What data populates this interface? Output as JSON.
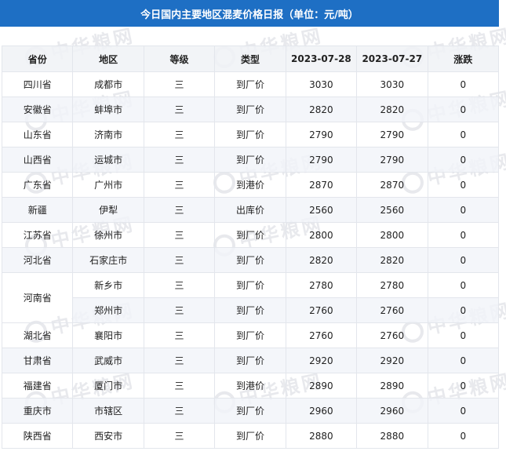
{
  "title": "今日国内主要地区混麦价格日报（单位：元/吨）",
  "watermark": "中华粮网",
  "headers": [
    "省份",
    "地区",
    "等级",
    "类型",
    "2023-07-28",
    "2023-07-27",
    "涨跌"
  ],
  "rows": [
    {
      "province": "四川省",
      "region": "成都市",
      "grade": "三",
      "type": "到厂价",
      "today": "3030",
      "prev": "3030",
      "change": "0"
    },
    {
      "province": "安徽省",
      "region": "蚌埠市",
      "grade": "三",
      "type": "到厂价",
      "today": "2820",
      "prev": "2820",
      "change": "0"
    },
    {
      "province": "山东省",
      "region": "济南市",
      "grade": "三",
      "type": "到厂价",
      "today": "2790",
      "prev": "2790",
      "change": "0"
    },
    {
      "province": "山西省",
      "region": "运城市",
      "grade": "三",
      "type": "到厂价",
      "today": "2790",
      "prev": "2790",
      "change": "0"
    },
    {
      "province": "广东省",
      "region": "广州市",
      "grade": "三",
      "type": "到港价",
      "today": "2870",
      "prev": "2870",
      "change": "0"
    },
    {
      "province": "新疆",
      "region": "伊犁",
      "grade": "三",
      "type": "出库价",
      "today": "2560",
      "prev": "2560",
      "change": "0"
    },
    {
      "province": "江苏省",
      "region": "徐州市",
      "grade": "三",
      "type": "到厂价",
      "today": "2800",
      "prev": "2800",
      "change": "0"
    },
    {
      "province": "河北省",
      "region": "石家庄市",
      "grade": "三",
      "type": "到厂价",
      "today": "2820",
      "prev": "2820",
      "change": "0"
    },
    {
      "province": "河南省",
      "region": "新乡市",
      "grade": "三",
      "type": "到厂价",
      "today": "2780",
      "prev": "2780",
      "change": "0"
    },
    {
      "province": "",
      "region": "郑州市",
      "grade": "三",
      "type": "到厂价",
      "today": "2760",
      "prev": "2760",
      "change": "0"
    },
    {
      "province": "湖北省",
      "region": "襄阳市",
      "grade": "三",
      "type": "到厂价",
      "today": "2760",
      "prev": "2760",
      "change": "0"
    },
    {
      "province": "甘肃省",
      "region": "武威市",
      "grade": "三",
      "type": "到厂价",
      "today": "2920",
      "prev": "2920",
      "change": "0"
    },
    {
      "province": "福建省",
      "region": "厦门市",
      "grade": "三",
      "type": "到港价",
      "today": "2890",
      "prev": "2890",
      "change": "0"
    },
    {
      "province": "重庆市",
      "region": "市辖区",
      "grade": "三",
      "type": "到厂价",
      "today": "2960",
      "prev": "2960",
      "change": "0"
    },
    {
      "province": "陕西省",
      "region": "西安市",
      "grade": "三",
      "type": "到厂价",
      "today": "2880",
      "prev": "2880",
      "change": "0"
    }
  ]
}
